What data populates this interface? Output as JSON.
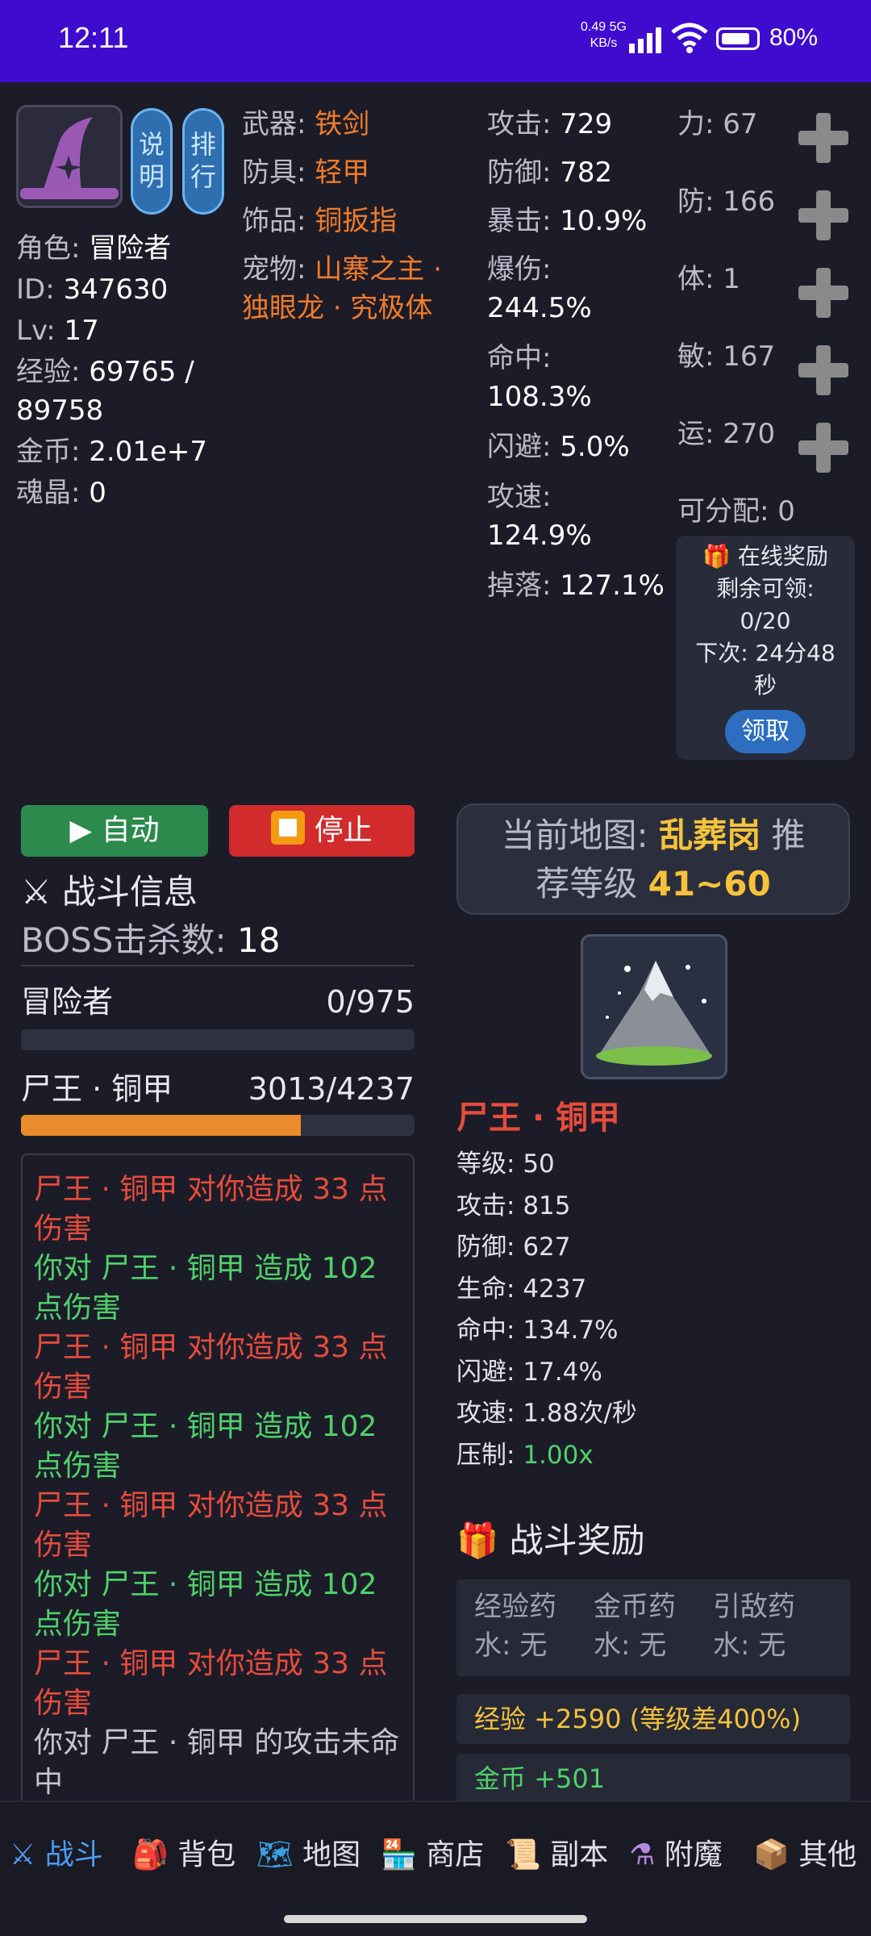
{
  "status_bar": {
    "time": "12:11",
    "net_speed": "0.49",
    "net_unit": "KB/s",
    "net_type": "5G",
    "battery": "80%"
  },
  "player": {
    "buttons": {
      "help": "说明",
      "rank": "排行"
    },
    "role_label": "角色",
    "role": "冒险者",
    "id_label": "ID",
    "id": "347630",
    "lv_label": "Lv",
    "lv": "17",
    "exp_label": "经验",
    "exp": "69765 /",
    "exp_max": "89758",
    "gold_label": "金币",
    "gold": "2.01e+7",
    "soul_label": "魂晶",
    "soul": "0"
  },
  "equipment": {
    "weapon_label": "武器",
    "weapon": "铁剑",
    "armor_label": "防具",
    "armor": "轻甲",
    "accessory_label": "饰品",
    "accessory": "铜扳指",
    "pet_label": "宠物",
    "pet_line1": "山寨之主 ·",
    "pet_line2": "独眼龙 · 究极体"
  },
  "combat_stats": {
    "atk_label": "攻击",
    "atk": "729",
    "def_label": "防御",
    "def": "782",
    "crit_label": "暴击",
    "crit": "10.9%",
    "critdmg_label": "爆伤",
    "critdmg": "244.5%",
    "hit_label": "命中",
    "hit": "108.3%",
    "dodge_label": "闪避",
    "dodge": "5.0%",
    "speed_label": "攻速",
    "speed": "124.9%",
    "drop_label": "掉落",
    "drop": "127.1%"
  },
  "attributes": {
    "str_label": "力",
    "str": "67",
    "def_label": "防",
    "def": "166",
    "con_label": "体",
    "con": "1",
    "agi_label": "敏",
    "agi": "167",
    "luck_label": "运",
    "luck": "270",
    "free_label": "可分配",
    "free": "0"
  },
  "online_reward": {
    "title": "在线奖励",
    "remain_label": "剩余可领:",
    "remain": "0/20",
    "next_label": "下次: 24分48",
    "next_unit": "秒",
    "claim": "领取"
  },
  "controls": {
    "auto": "自动",
    "stop": "停止"
  },
  "battle": {
    "title": "战斗信息",
    "boss_kills_label": "BOSS击杀数",
    "boss_kills": "18",
    "player_name": "冒险者",
    "player_hp": "0/975",
    "player_hp_fraction": 0,
    "enemy_name": "尸王 · 铜甲",
    "enemy_hp": "3013/4237",
    "enemy_hp_fraction": 0.711
  },
  "battle_log": [
    {
      "text": "尸王 · 铜甲 对你造成 33 点伤害",
      "type": "red"
    },
    {
      "text": "你对 尸王 · 铜甲 造成 102 点伤害",
      "type": "green"
    },
    {
      "text": "尸王 · 铜甲 对你造成 33 点伤害",
      "type": "red"
    },
    {
      "text": "你对 尸王 · 铜甲 造成 102 点伤害",
      "type": "green"
    },
    {
      "text": "尸王 · 铜甲 对你造成 33 点伤害",
      "type": "red"
    },
    {
      "text": "你对 尸王 · 铜甲 造成 102 点伤害",
      "type": "green"
    },
    {
      "text": "尸王 · 铜甲 对你造成 33 点伤害",
      "type": "red"
    },
    {
      "text": "你对 尸王 · 铜甲 的攻击未命中",
      "type": "gray"
    }
  ],
  "map": {
    "current_label": "当前地图:",
    "current": "乱葬岗",
    "rec_label_1": "推",
    "rec_label_2": "荐等级",
    "rec_range": "41~60"
  },
  "monster": {
    "name": "尸王 · 铜甲",
    "level_label": "等级",
    "level": "50",
    "atk_label": "攻击",
    "atk": "815",
    "def_label": "防御",
    "def": "627",
    "hp_label": "生命",
    "hp": "4237",
    "hit_label": "命中",
    "hit": "134.7%",
    "dodge_label": "闪避",
    "dodge": "17.4%",
    "speed_label": "攻速",
    "speed": "1.88次/秒",
    "suppress_label": "压制",
    "suppress": "1.00x"
  },
  "battle_rewards": {
    "title": "战斗奖励",
    "potion1_a": "经验药",
    "potion1_b": "水: 无",
    "potion2_a": "金币药",
    "potion2_b": "水: 无",
    "potion3_a": "引敌药",
    "potion3_b": "水: 无",
    "exp": "经验 +2590 (等级差400%)",
    "gold": "金币 +501"
  },
  "nav": [
    "战斗",
    "背包",
    "地图",
    "商店",
    "副本",
    "附魔",
    "其他"
  ],
  "colors": {
    "accent": "#3f0ccf",
    "orange": "#f07b2a",
    "gold": "#f5c23a",
    "red": "#e74c3c",
    "green": "#4fd16a",
    "active_tab": "#4a9bf0"
  }
}
